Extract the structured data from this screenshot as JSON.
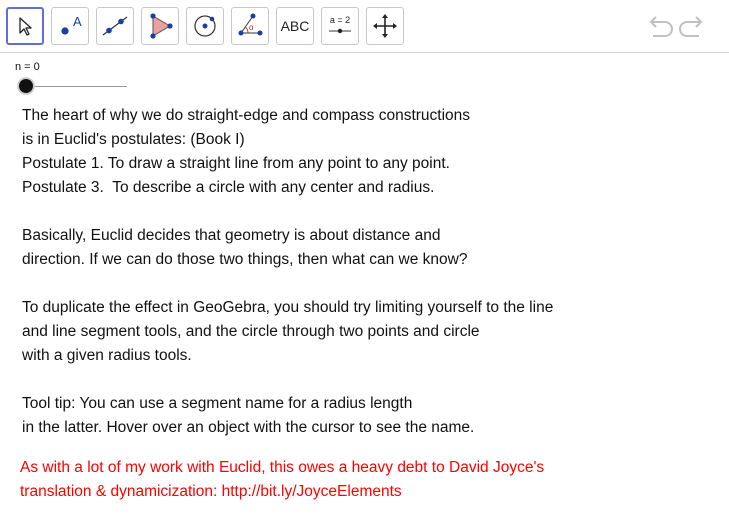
{
  "toolbar": {
    "tools": [
      {
        "name": "move-tool",
        "icon": "arrow-cursor-icon",
        "selected": true
      },
      {
        "name": "point-tool",
        "icon": "point-label-icon",
        "label": "A"
      },
      {
        "name": "line-tool",
        "icon": "line-through-points-icon"
      },
      {
        "name": "polygon-tool",
        "icon": "triangle-icon"
      },
      {
        "name": "circle-tool",
        "icon": "circle-center-point-icon"
      },
      {
        "name": "angle-tool",
        "icon": "angle-icon",
        "label": "α"
      },
      {
        "name": "text-tool",
        "label": "ABC"
      },
      {
        "name": "slider-tool",
        "label": "a = 2"
      },
      {
        "name": "move-graphics-view-tool",
        "icon": "four-way-arrow-icon"
      }
    ],
    "undo_icon": "undo-icon",
    "redo_icon": "redo-icon"
  },
  "slider": {
    "label": "n = 0",
    "value": 0
  },
  "text": {
    "p1": [
      "The heart of why we do straight-edge and compass constructions",
      "is in Euclid's postulates: (Book I)",
      "Postulate 1. To draw a straight line from any point to any point.",
      "Postulate 3.  To describe a circle with any center and radius."
    ],
    "p2": [
      "Basically, Euclid decides that geometry is about distance and",
      "direction. If we can do those two things, then what can we know?"
    ],
    "p3": [
      "To duplicate the effect in GeoGebra, you should try limiting yourself to the line",
      "and line segment tools, and the circle through two points and circle",
      "with a given radius tools."
    ],
    "p4": [
      "Tool tip: You can use a segment name for a radius length",
      "in the latter. Hover over an object with the cursor to see the name."
    ],
    "credit": [
      "As with a lot of my work with Euclid, this owes a heavy debt to David Joyce's",
      "translation & dynamicization: http://bit.ly/JoyceElements"
    ]
  },
  "colors": {
    "accent": "#5f6fd6",
    "credit": "#ff0000",
    "point": "#1a3fa0"
  }
}
